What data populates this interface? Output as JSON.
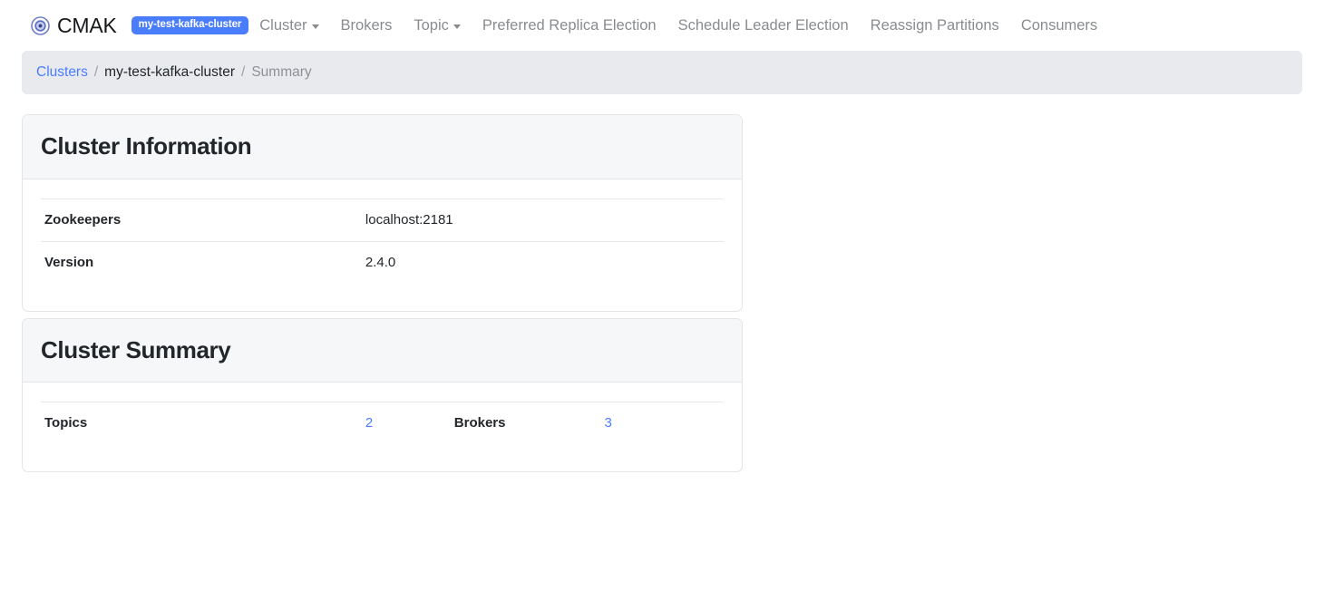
{
  "navbar": {
    "brand_label": "CMAK",
    "brand_icon": "target-icon",
    "cluster_badge": "my-test-kafka-cluster",
    "accent_color": "#4a7dfc",
    "items": [
      {
        "label": "Cluster",
        "has_caret": true
      },
      {
        "label": "Brokers",
        "has_caret": false
      },
      {
        "label": "Topic",
        "has_caret": true
      },
      {
        "label": "Preferred Replica Election",
        "has_caret": false
      },
      {
        "label": "Schedule Leader Election",
        "has_caret": false
      },
      {
        "label": "Reassign Partitions",
        "has_caret": false
      },
      {
        "label": "Consumers",
        "has_caret": false
      }
    ]
  },
  "breadcrumb": {
    "root": "Clusters",
    "sep": "/",
    "cluster": "my-test-kafka-cluster",
    "current": "Summary"
  },
  "cluster_information": {
    "title": "Cluster Information",
    "rows": [
      {
        "key": "Zookeepers",
        "value": "localhost:2181"
      },
      {
        "key": "Version",
        "value": "2.4.0"
      }
    ]
  },
  "cluster_summary": {
    "title": "Cluster Summary",
    "rows": [
      {
        "key_1": "Topics",
        "value_1": "2",
        "key_2": "Brokers",
        "value_2": "3"
      }
    ]
  }
}
